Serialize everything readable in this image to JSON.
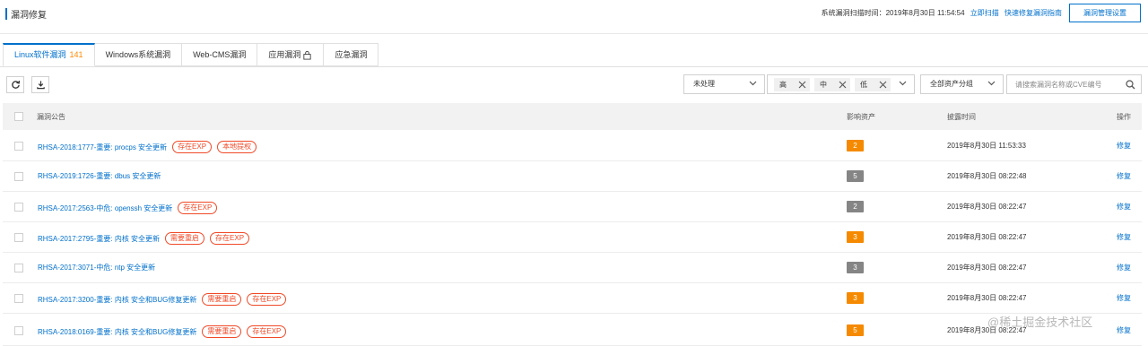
{
  "header": {
    "title": "漏洞修复",
    "scan_label": "系统漏洞扫描时间：2019年8月30日 11:54:54",
    "scan_now_link": "立即扫描",
    "quick_guide_link": "快速修复漏洞指南",
    "manage_button": "漏洞管理设置"
  },
  "tabs": [
    {
      "label": "Linux软件漏洞",
      "count": "141",
      "active": true
    },
    {
      "label": "Windows系统漏洞"
    },
    {
      "label": "Web-CMS漏洞"
    },
    {
      "label": "应用漏洞",
      "icon": "lock-icon"
    },
    {
      "label": "应急漏洞"
    }
  ],
  "toolbar": {
    "refresh_icon": "refresh-icon",
    "download_icon": "download-icon",
    "status_filter": "未处理",
    "level_chips": [
      "高",
      "中",
      "低"
    ],
    "asset_group": "全部资产分组",
    "search_placeholder": "请搜索漏洞名称或CVE编号"
  },
  "table": {
    "columns": [
      "漏洞公告",
      "影响资产",
      "披露时间",
      "操作"
    ],
    "rows": [
      {
        "name": "RHSA-2018:1777-重要: procps 安全更新",
        "tags": [
          "存在EXP",
          "本地提权"
        ],
        "assets": "2",
        "level": "high",
        "time": "2019年8月30日 11:53:33",
        "action": "修复"
      },
      {
        "name": "RHSA-2019:1726-重要: dbus 安全更新",
        "tags": [],
        "assets": "5",
        "level": "medium",
        "time": "2019年8月30日 08:22:48",
        "action": "修复"
      },
      {
        "name": "RHSA-2017:2563-中危: openssh 安全更新",
        "tags": [
          "存在EXP"
        ],
        "assets": "2",
        "level": "medium",
        "time": "2019年8月30日 08:22:47",
        "action": "修复"
      },
      {
        "name": "RHSA-2017:2795-重要: 内核 安全更新",
        "tags": [
          "需要重启",
          "存在EXP"
        ],
        "assets": "3",
        "level": "high",
        "time": "2019年8月30日 08:22:47",
        "action": "修复"
      },
      {
        "name": "RHSA-2017:3071-中危: ntp 安全更新",
        "tags": [],
        "assets": "3",
        "level": "medium",
        "time": "2019年8月30日 08:22:47",
        "action": "修复"
      },
      {
        "name": "RHSA-2017:3200-重要: 内核 安全和BUG修复更新",
        "tags": [
          "需要重启",
          "存在EXP"
        ],
        "assets": "3",
        "level": "high",
        "time": "2019年8月30日 08:22:47",
        "action": "修复"
      },
      {
        "name": "RHSA-2018:0169-重要: 内核 安全和BUG修复更新",
        "tags": [
          "需要重启",
          "存在EXP"
        ],
        "assets": "5",
        "level": "high",
        "time": "2019年8月30日 08:22:47",
        "action": "修复"
      }
    ]
  },
  "watermark": "@稀土掘金技术社区",
  "colors": {
    "accent": "#0070cc",
    "high": "#f58a00",
    "medium": "#858585",
    "tag": "#f04a28",
    "count": "#ff8a00"
  }
}
